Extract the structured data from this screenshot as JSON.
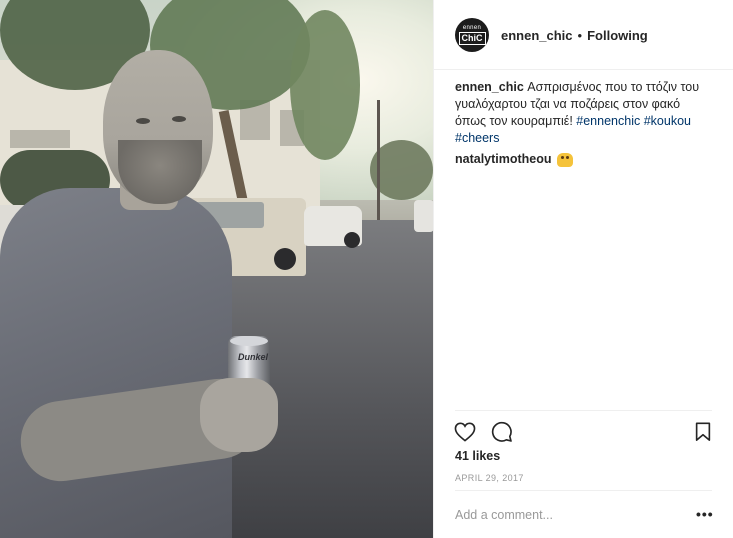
{
  "post": {
    "image_alt_brand_on_can": "Dunkel"
  },
  "header": {
    "avatar_line1": "ennen",
    "avatar_line2": "ChiC",
    "username": "ennen_chic",
    "separator": "•",
    "follow_state": "Following"
  },
  "comments": [
    {
      "user": "ennen_chic",
      "text": "Ασπρισμένος που το ττόζιν του γυαλόχαρτου τζαι να ποζάρεις στον φακό όπως τον κουραμπιέ!",
      "hashtags": [
        "#ennenchic",
        "#koukou",
        "#cheers"
      ]
    },
    {
      "user": "natalytimotheou",
      "emoji": "raised-hands-emoji"
    }
  ],
  "actions": {
    "like_icon": "heart-icon",
    "comment_icon": "comment-icon",
    "save_icon": "bookmark-icon"
  },
  "likes": "41 likes",
  "date": "APRIL 29, 2017",
  "comment_input": {
    "placeholder": "Add a comment..."
  },
  "more_options": "•••"
}
